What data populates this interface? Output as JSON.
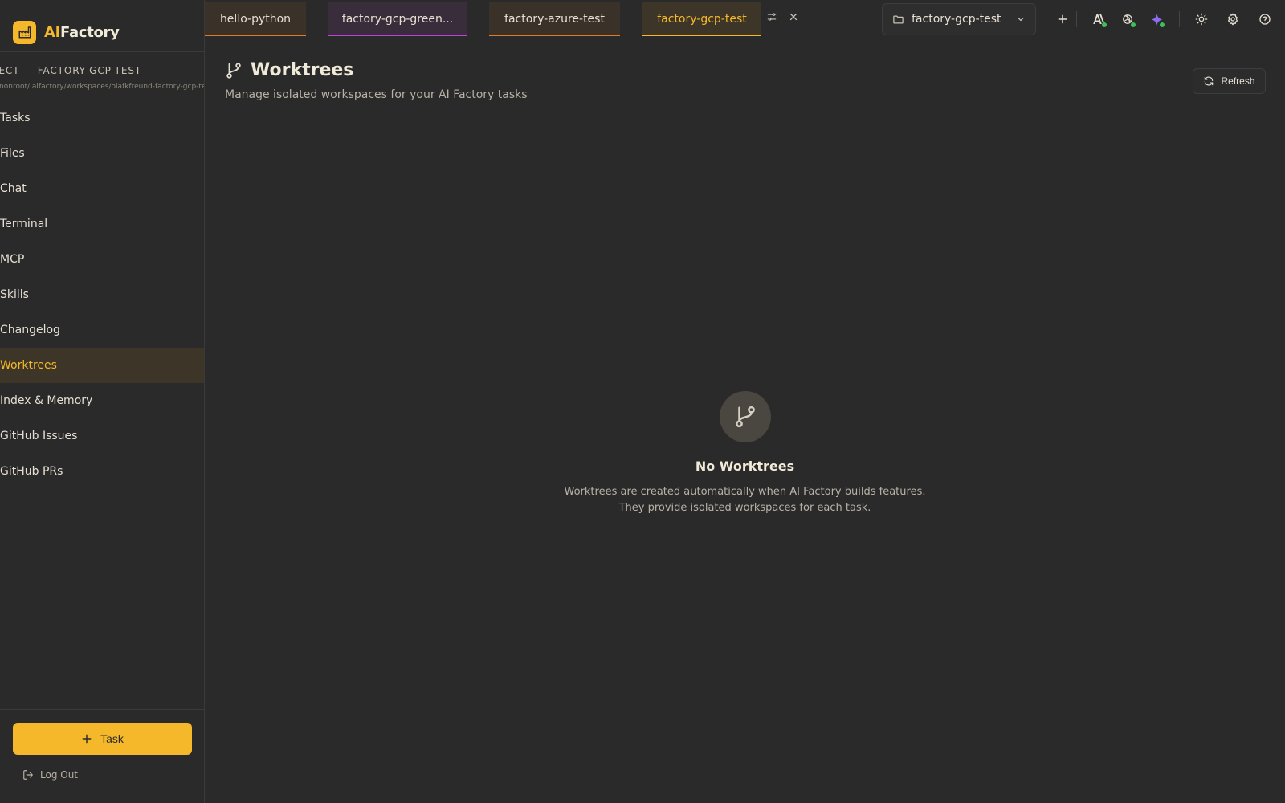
{
  "brand": {
    "prefix": "AI",
    "suffix": "Factory"
  },
  "sidebar": {
    "project_title": "JECT — FACTORY-GCP-TEST",
    "project_path": "/nonroot/.aifactory/workspaces/olafkfreund-factory-gcp-te",
    "items": [
      {
        "label": "Tasks"
      },
      {
        "label": "Files"
      },
      {
        "label": "Chat"
      },
      {
        "label": "Terminal"
      },
      {
        "label": "MCP"
      },
      {
        "label": "Skills"
      },
      {
        "label": "Changelog"
      },
      {
        "label": "Worktrees",
        "active": true
      },
      {
        "label": "Index & Memory"
      },
      {
        "label": "GitHub Issues"
      },
      {
        "label": "GitHub PRs"
      }
    ],
    "task_button": "Task",
    "logout": "Log Out"
  },
  "tabs": [
    {
      "label": "hello-python",
      "color": "#e07b2a"
    },
    {
      "label": "factory-gcp-green...",
      "color": "#c43fe0"
    },
    {
      "label": "factory-azure-test",
      "color": "#e07b2a"
    },
    {
      "label": "factory-gcp-test",
      "color": "#f5b82a",
      "active": true
    }
  ],
  "project_select": {
    "value": "factory-gcp-test"
  },
  "page": {
    "title": "Worktrees",
    "subtitle": "Manage isolated workspaces for your AI Factory tasks",
    "refresh": "Refresh"
  },
  "empty_state": {
    "title": "No Worktrees",
    "line1": "Worktrees are created automatically when AI Factory builds features.",
    "line2": "They provide isolated workspaces for each task."
  },
  "colors": {
    "accent": "#f5b82a",
    "status_green": "#3fbf5a"
  }
}
